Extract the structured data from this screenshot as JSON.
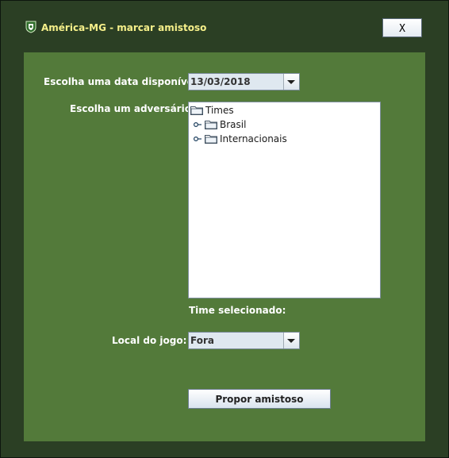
{
  "window": {
    "title": "América-MG - marcar amistoso",
    "close_label": "X",
    "icon": "club-shield-icon"
  },
  "form": {
    "date_label": "Escolha uma data disponível:",
    "date_value": "13/03/2018",
    "opponent_label": "Escolha um adversário:",
    "tree": {
      "root": "Times",
      "children": [
        "Brasil",
        "Internacionais"
      ]
    },
    "selected_team_label": "Time selecionado:",
    "venue_label": "Local do jogo:",
    "venue_value": "Fora",
    "submit_label": "Propor amistoso"
  },
  "colors": {
    "outer_bg": "#2b3f24",
    "panel_bg": "#537a3a",
    "title_text": "#f6f08a",
    "label_text": "#ffffff"
  }
}
